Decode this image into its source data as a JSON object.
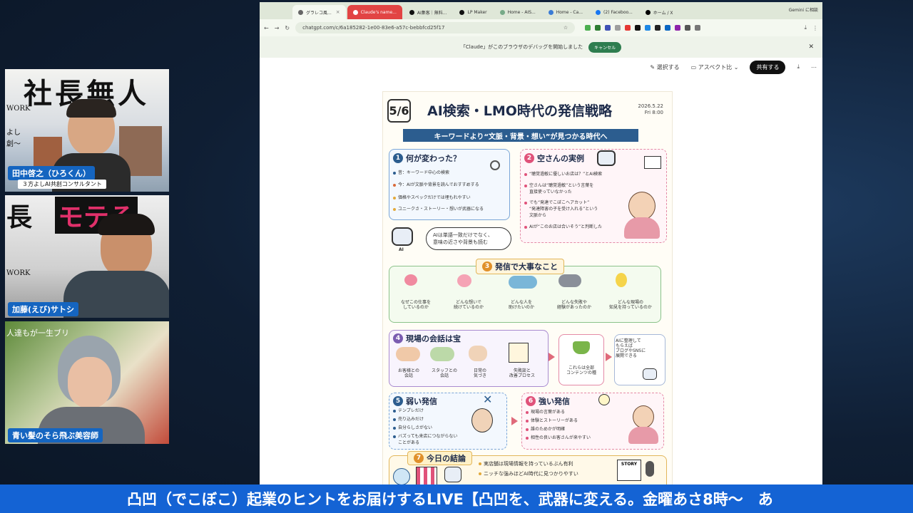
{
  "ticker": "凸凹（でこぼこ）起業のヒントをお届けするLIVE【凸凹を、武器に変える。金曜あさ8時〜　あ",
  "participants": [
    {
      "name": "田中啓之（ひろくん）",
      "subtitle": "３方よしAI共創コンサルタント",
      "bg_text": "社長無人",
      "bg_text2": "WORK",
      "bg_text3": "よし",
      "bg_text4": "創〜"
    },
    {
      "name": "加藤(えび)サトシ",
      "bg_text": "長",
      "bg_text_pink": "モテる",
      "bg_text2": "WORK"
    },
    {
      "name": "青い髪のそら飛ぶ美容師",
      "bg_text": "人達もが一生ブリ"
    }
  ],
  "browser": {
    "tabs": [
      {
        "label": "グラレコ風...",
        "active": true
      },
      {
        "label": "Claude's name...",
        "active": false
      },
      {
        "label": "AI集客｜無料...",
        "active": false
      },
      {
        "label": "LP Maker",
        "active": false
      },
      {
        "label": "Home - AIS...",
        "active": false
      },
      {
        "label": "Home - Ca...",
        "active": false
      },
      {
        "label": "(2) Faceboo...",
        "active": false
      },
      {
        "label": "ホーム / X",
        "active": false
      }
    ],
    "gemini_label": "Gemini に相談",
    "url": "chatgpt.com/c/6a185282-1e00-83e6-a57c-bebbfcd25f17",
    "infobar_text": "「Claude」がこのブラウザのデバッグを開始しました",
    "infobar_cancel": "キャンセル",
    "tools": {
      "select": "選択する",
      "aspect": "アスペクト比",
      "share": "共有する"
    }
  },
  "infographic": {
    "page_num": "5/6",
    "title": "AI検索・LMO時代の発信戦略",
    "date_line1": "2026.5.22",
    "date_line2": "Fri 8:00",
    "ribbon": "キーワードより“文脈・背景・想い”が見つかる時代へ",
    "sec1": {
      "num": "1",
      "title": "何が変わった？",
      "items": [
        "昔：キーワード中心の検索",
        "今：AIが文脈や背景を読んでおすすめする",
        "価格やスペックだけでは埋もれやすい",
        "ユニークさ・ストーリー・想いが武器になる"
      ]
    },
    "sec2": {
      "num": "2",
      "title": "空さんの実例",
      "items": [
        "“聴覚過敏に優しいお店は？”とAI検索",
        "空さんは“聴覚過敏”という言葉を",
        "直接使っていなかった",
        "でも“発達でこぼこヘアカット”",
        "“発達障害の子を受け入れる”という",
        "文脈から",
        "AIが“このお店は合いそう”と判断した"
      ]
    },
    "robot_bubble1": "AIは単語一致だけでなく、",
    "robot_bubble2": "意味の近さや背景も読む",
    "ai_label": "AI",
    "sec3": {
      "num": "3",
      "title": "発信で大事なこと",
      "cards": [
        "なぜこの仕事を|しているのか",
        "どんな想いで|続けているのか",
        "どんな人を|助けたいのか",
        "どんな失敗や|経験があったのか",
        "どんな現場の|知見を持っているのか"
      ]
    },
    "sec4": {
      "num": "4",
      "title": "現場の会話は宝",
      "cards": [
        "お客様との|会話",
        "スタッフとの|会話",
        "日常の|気づき",
        "失敗談と|改善プロセス"
      ],
      "middle": "これらは全部|コンテンツの種",
      "right": "AIに整理して|もらえば|ブログやSNSに|展開できる"
    },
    "sec5": {
      "num": "5",
      "title": "弱い発信",
      "items": [
        "テンプレだけ",
        "売り込みだけ",
        "自分らしさがない",
        "バズっても来店につながらない",
        "ことがある"
      ]
    },
    "sec6": {
      "num": "6",
      "title": "強い発信",
      "items": [
        "現場の言葉がある",
        "体験とストーリーがある",
        "誰のためかが明確",
        "相性の良いお客さんが来やすい"
      ]
    },
    "sec7": {
      "num": "7",
      "title": "今日の結論",
      "items": [
        "実店舗は現場情報を持っているぶん有利",
        "ニッチな強みほどAI時代に見つかりやすい"
      ],
      "story_label": "STORY"
    }
  }
}
